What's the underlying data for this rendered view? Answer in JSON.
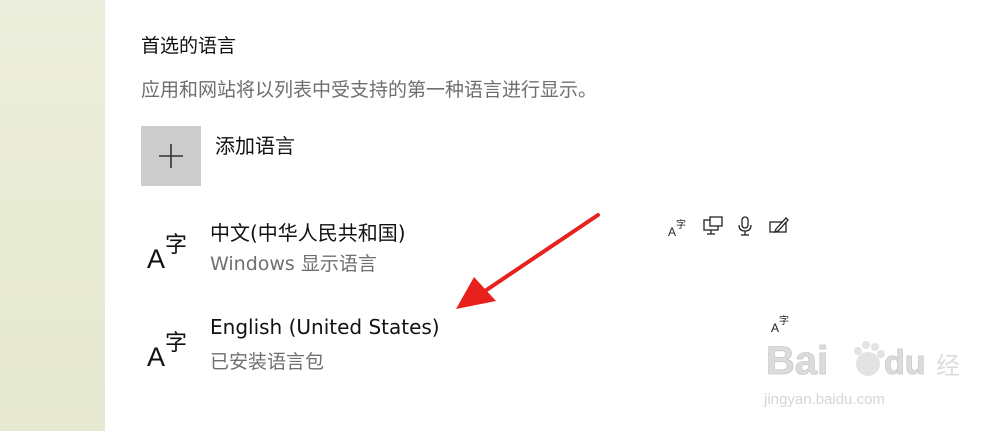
{
  "preferred_languages": {
    "title": "首选的语言",
    "description": "应用和网站将以列表中受支持的第一种语言进行显示。",
    "add_button": {
      "icon": "plus-icon",
      "label": "添加语言"
    },
    "languages": [
      {
        "name": "中文(中华人民共和国)",
        "subtitle": "Windows 显示语言",
        "icon": "language-icon",
        "feature_icons": [
          "language-pack-icon",
          "display-language-icon",
          "speech-icon",
          "handwriting-icon"
        ]
      },
      {
        "name": "English (United States)",
        "subtitle": "已安装语言包",
        "icon": "language-icon",
        "feature_icons": [
          "language-pack-icon"
        ]
      }
    ]
  },
  "annotation": {
    "arrow_color": "#e8211d"
  },
  "watermark": {
    "brand": "Bai百du经验",
    "url": "jingyan.baidu.com"
  },
  "colors": {
    "sidebar_bg": "#e8ebd3",
    "add_button_bg": "#cccccc",
    "secondary_text": "#6f6f6f"
  }
}
